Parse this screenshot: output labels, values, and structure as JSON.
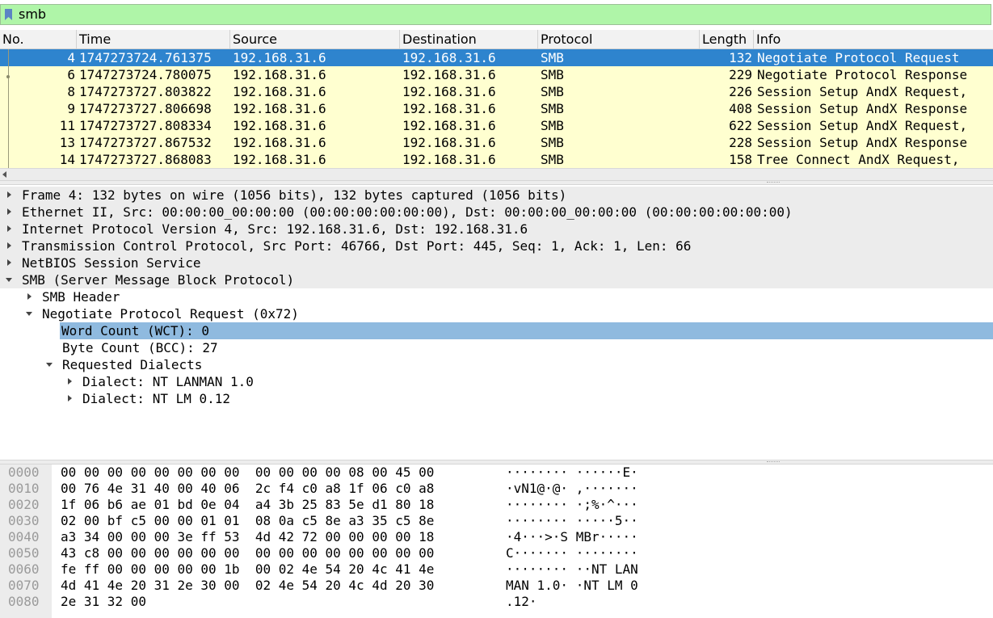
{
  "filter": {
    "value": "smb"
  },
  "packet_list": {
    "columns": [
      "No.",
      "Time",
      "Source",
      "Destination",
      "Protocol",
      "Length",
      "Info"
    ],
    "rows": [
      {
        "no": "4",
        "time": "1747273724.761375",
        "source": "192.168.31.6",
        "destination": "192.168.31.6",
        "protocol": "SMB",
        "length": "132",
        "info": "Negotiate Protocol Request",
        "selected": true
      },
      {
        "no": "6",
        "time": "1747273724.780075",
        "source": "192.168.31.6",
        "destination": "192.168.31.6",
        "protocol": "SMB",
        "length": "229",
        "info": "Negotiate Protocol Response"
      },
      {
        "no": "8",
        "time": "1747273727.803822",
        "source": "192.168.31.6",
        "destination": "192.168.31.6",
        "protocol": "SMB",
        "length": "226",
        "info": "Session Setup AndX Request,"
      },
      {
        "no": "9",
        "time": "1747273727.806698",
        "source": "192.168.31.6",
        "destination": "192.168.31.6",
        "protocol": "SMB",
        "length": "408",
        "info": "Session Setup AndX Response"
      },
      {
        "no": "11",
        "time": "1747273727.808334",
        "source": "192.168.31.6",
        "destination": "192.168.31.6",
        "protocol": "SMB",
        "length": "622",
        "info": "Session Setup AndX Request,"
      },
      {
        "no": "13",
        "time": "1747273727.867532",
        "source": "192.168.31.6",
        "destination": "192.168.31.6",
        "protocol": "SMB",
        "length": "228",
        "info": "Session Setup AndX Response"
      },
      {
        "no": "14",
        "time": "1747273727.868083",
        "source": "192.168.31.6",
        "destination": "192.168.31.6",
        "protocol": "SMB",
        "length": "158",
        "info": "Tree Connect AndX Request,"
      }
    ]
  },
  "details": {
    "rows": [
      {
        "text": "Frame 4: 132 bytes on wire (1056 bits), 132 bytes captured (1056 bits)",
        "expander": "collapsed",
        "level": 0,
        "style": "gray"
      },
      {
        "text": "Ethernet II, Src: 00:00:00_00:00:00 (00:00:00:00:00:00), Dst: 00:00:00_00:00:00 (00:00:00:00:00:00)",
        "expander": "collapsed",
        "level": 0,
        "style": "gray"
      },
      {
        "text": "Internet Protocol Version 4, Src: 192.168.31.6, Dst: 192.168.31.6",
        "expander": "collapsed",
        "level": 0,
        "style": "gray"
      },
      {
        "text": "Transmission Control Protocol, Src Port: 46766, Dst Port: 445, Seq: 1, Ack: 1, Len: 66",
        "expander": "collapsed",
        "level": 0,
        "style": "gray"
      },
      {
        "text": "NetBIOS Session Service",
        "expander": "collapsed",
        "level": 0,
        "style": "gray"
      },
      {
        "text": "SMB (Server Message Block Protocol)",
        "expander": "expanded",
        "level": 0,
        "style": "gray"
      },
      {
        "text": "SMB Header",
        "expander": "collapsed",
        "level": 1,
        "style": ""
      },
      {
        "text": "Negotiate Protocol Request (0x72)",
        "expander": "expanded",
        "level": 1,
        "style": ""
      },
      {
        "text": "Word Count (WCT): 0",
        "expander": "none",
        "level": 2,
        "style": "hl"
      },
      {
        "text": "Byte Count (BCC): 27",
        "expander": "none",
        "level": 2,
        "style": ""
      },
      {
        "text": "Requested Dialects",
        "expander": "expanded",
        "level": 2,
        "style": ""
      },
      {
        "text": "Dialect: NT LANMAN 1.0",
        "expander": "collapsed",
        "level": 3,
        "style": ""
      },
      {
        "text": "Dialect: NT LM 0.12",
        "expander": "collapsed",
        "level": 3,
        "style": ""
      }
    ]
  },
  "bytes": {
    "rows": [
      {
        "offset": "0000",
        "hex": "00 00 00 00 00 00 00 00  00 00 00 00 08 00 45 00",
        "ascii": "········ ······E·"
      },
      {
        "offset": "0010",
        "hex": "00 76 4e 31 40 00 40 06  2c f4 c0 a8 1f 06 c0 a8",
        "ascii": "·vN1@·@· ,·······"
      },
      {
        "offset": "0020",
        "hex": "1f 06 b6 ae 01 bd 0e 04  a4 3b 25 83 5e d1 80 18",
        "ascii": "········ ·;%·^···"
      },
      {
        "offset": "0030",
        "hex": "02 00 bf c5 00 00 01 01  08 0a c5 8e a3 35 c5 8e",
        "ascii": "········ ·····5··"
      },
      {
        "offset": "0040",
        "hex": "a3 34 00 00 00 3e ff 53  4d 42 72 00 00 00 00 18",
        "ascii": "·4···>·S MBr·····"
      },
      {
        "offset": "0050",
        "hex": "43 c8 00 00 00 00 00 00  00 00 00 00 00 00 00 00",
        "ascii": "C······· ········"
      },
      {
        "offset": "0060",
        "hex": "fe ff 00 00 00 00 00 1b  00 02 4e 54 20 4c 41 4e",
        "ascii": "········ ··NT LAN"
      },
      {
        "offset": "0070",
        "hex": "4d 41 4e 20 31 2e 30 00  02 4e 54 20 4c 4d 20 30",
        "ascii": "MAN 1.0· ·NT LM 0"
      },
      {
        "offset": "0080",
        "hex": "2e 31 32 00",
        "ascii": ".12·"
      }
    ]
  },
  "colors": {
    "filter_valid_bg": "#aff5a8",
    "selected_row_bg": "#2e84ce",
    "smb_row_bg": "#ffffd0",
    "detail_highlight_bg": "#8fbadf"
  }
}
